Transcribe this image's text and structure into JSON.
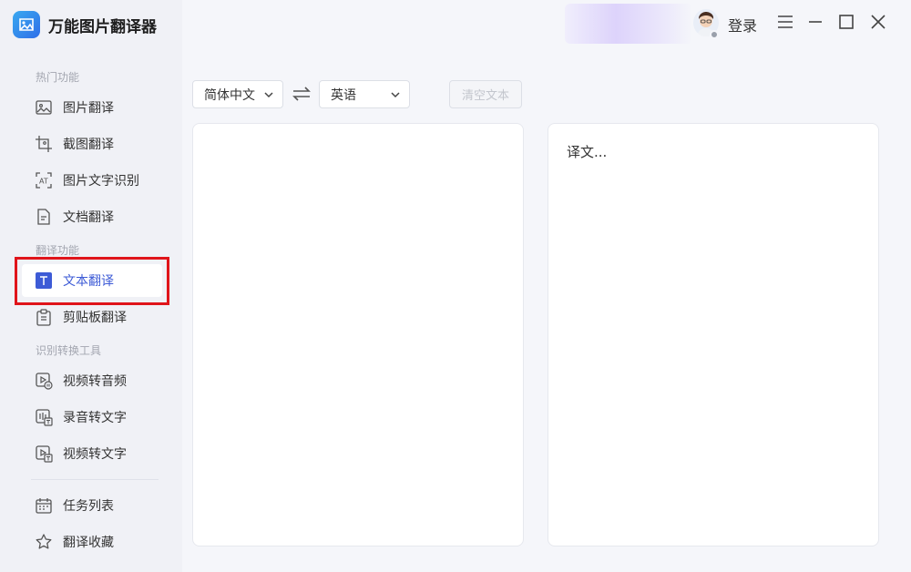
{
  "app": {
    "title": "万能图片翻译器"
  },
  "header": {
    "login_label": "登录"
  },
  "sidebar": {
    "sections": [
      {
        "label": "热门功能",
        "items": [
          {
            "label": "图片翻译",
            "icon": "image-icon"
          },
          {
            "label": "截图翻译",
            "icon": "screenshot-icon"
          },
          {
            "label": "图片文字识别",
            "icon": "ocr-icon"
          },
          {
            "label": "文档翻译",
            "icon": "document-icon"
          }
        ]
      },
      {
        "label": "翻译功能",
        "items": [
          {
            "label": "文本翻译",
            "icon": "text-t-icon",
            "active": true
          },
          {
            "label": "剪贴板翻译",
            "icon": "clipboard-icon"
          }
        ]
      },
      {
        "label": "识别转换工具",
        "items": [
          {
            "label": "视频转音频",
            "icon": "video-audio-icon"
          },
          {
            "label": "录音转文字",
            "icon": "recording-text-icon"
          },
          {
            "label": "视频转文字",
            "icon": "video-text-icon"
          }
        ]
      }
    ],
    "bottom_items": [
      {
        "label": "任务列表",
        "icon": "calendar-icon"
      },
      {
        "label": "翻译收藏",
        "icon": "star-icon"
      }
    ]
  },
  "toolbar": {
    "source_lang": "简体中文",
    "target_lang": "英语",
    "clear_label": "清空文本"
  },
  "editor": {
    "source_text": "",
    "target_placeholder": "译文..."
  },
  "colors": {
    "accent": "#3d5bd6",
    "highlight_outline": "#e0141a",
    "logo": "#2f6ee8"
  }
}
